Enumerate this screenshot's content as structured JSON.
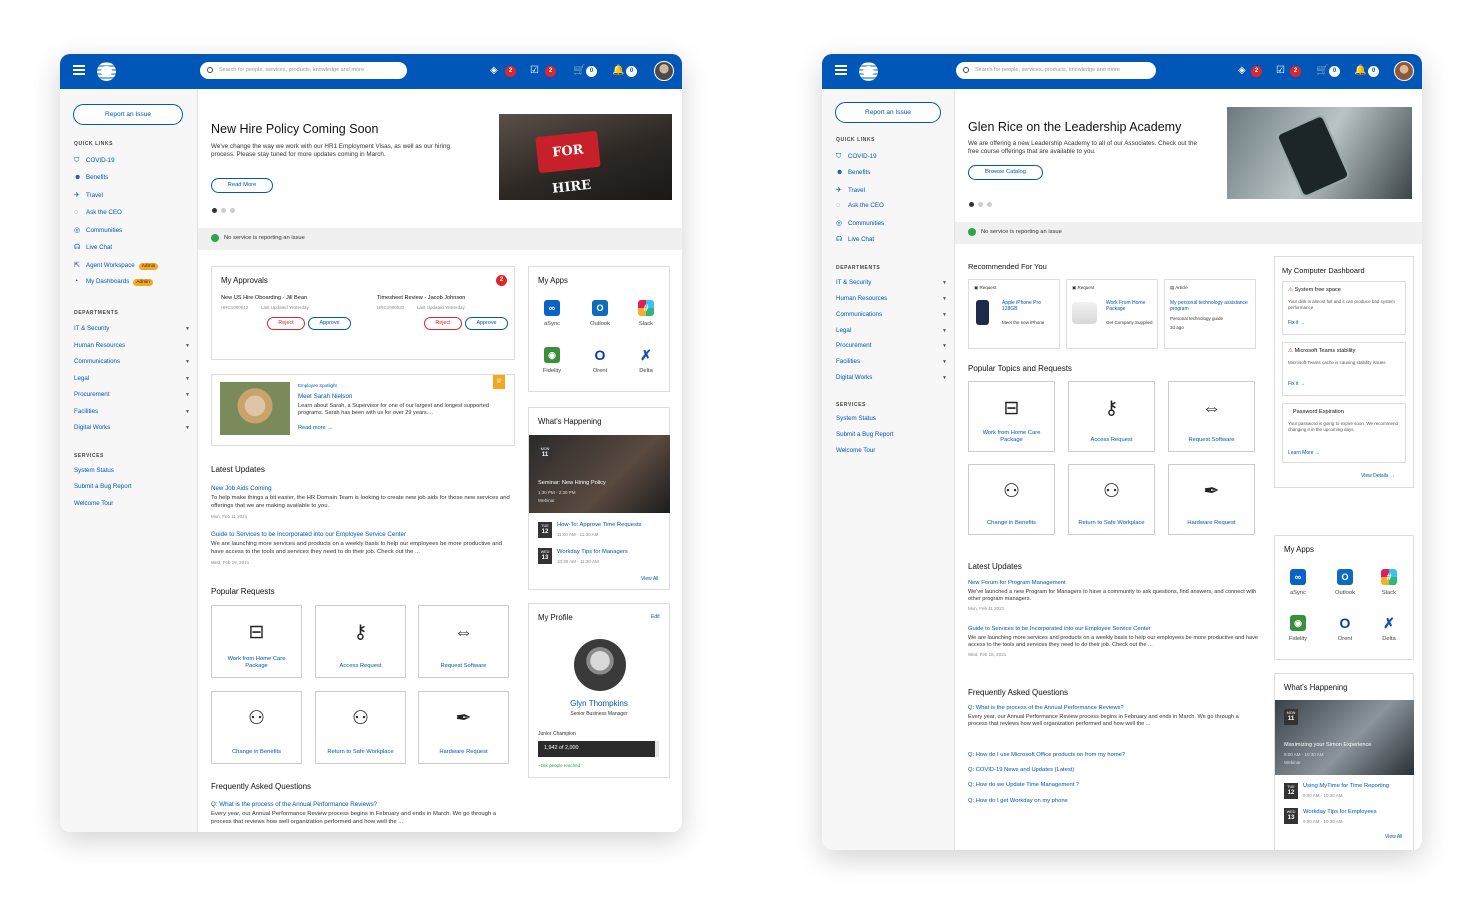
{
  "search": {
    "placeholder": "Search for people, services, products, knowledge and more"
  },
  "header": {
    "tickets_count": "2",
    "tasks_count": "2",
    "cart_count": "0",
    "notifications_count": "0"
  },
  "sidebar": {
    "report_button": "Report an Issue",
    "quick_links_heading": "QUICK LINKS",
    "departments_heading": "DEPARTMENTS",
    "services_heading": "SERVICES",
    "admin_badge": "Admin",
    "quick_links_a": [
      "COVID-19",
      "Benefits",
      "Travel",
      "Ask the CEO",
      "Communities",
      "Live Chat",
      "Agent Workspace",
      "My Dashboards"
    ],
    "quick_links_b": [
      "COVID-19",
      "Benefits",
      "Travel",
      "Ask the CEO",
      "Communities",
      "Live Chat"
    ],
    "departments": [
      "IT & Security",
      "Human Resources",
      "Communications",
      "Legal",
      "Procurement",
      "Facilities",
      "Digital Works"
    ],
    "services": [
      "System Status",
      "Submit a Bug Report",
      "Welcome Tour"
    ]
  },
  "screen_a": {
    "hero": {
      "title": "New Hire Policy Coming Soon",
      "desc": "We've change the way we work with our HR1 Employment Visas, as well as our hiring process. Please stay tuned for more updates coming in March.",
      "button": "Read More",
      "image_sign": "FOR HIRE"
    },
    "status": "No service is reporting an issue",
    "approvals": {
      "title": "My Approvals",
      "count": "2",
      "items": [
        {
          "title": "New US Hire Oboarding - Jill Bean",
          "id": "HRC1000012",
          "updated": "Last Updated Yesterday",
          "reject": "Reject",
          "approve": "Approve"
        },
        {
          "title": "Timesheet Review - Jacob Johnson",
          "id": "HRC1000032",
          "updated": "Last Updated Yesterday",
          "reject": "Reject",
          "approve": "Approve"
        }
      ]
    },
    "spotlight": {
      "tag": "Employee Spotlight",
      "name": "Meet Sarah Nielson",
      "desc": "Learn about Sarah, a Supervisor for one of our largest and longest supported programs. Sarah has been with us for over 29 years....",
      "link": "Read more →"
    },
    "latest_updates": {
      "title": "Latest Updates",
      "items": [
        {
          "title": "New Job Aids Coming",
          "desc": "To help make things a bit easier, the HR Domain Team is looking to create new job aids for those new services and offerings that we are making available to you.",
          "date": "Mon, Feb 11 2021"
        },
        {
          "title": "Guide to Services to be Incorporated into our Employee Service Center",
          "desc": "We are launching more services and products on a weekly basis to help our employees be more productive and have access to the tools and services they need to do their job. Check out the ...",
          "date": "Wed, Feb 18, 2021"
        }
      ]
    },
    "popular_requests": {
      "title": "Popular Requests",
      "items": [
        "Work from Home Care Package",
        "Access Request",
        "Request Software",
        "Change in Benefits",
        "Return to Safe Workplace",
        "Hardware Request"
      ]
    },
    "faq": {
      "title": "Frequently Asked Questions",
      "q1": "Q: What is the process of the Annual Performance Reviews?",
      "a1": "Every year, our Annual Performance Review process begins in February and ends in March. We go through a process that reviews how well organization performed and how well the ..."
    },
    "apps": {
      "title": "My Apps",
      "items": [
        "aSync",
        "Outlook",
        "Slack",
        "Fidelity",
        "Orent",
        "Delta"
      ]
    },
    "happening": {
      "title": "What's Happening",
      "featured": {
        "month": "MON",
        "day": "11",
        "title": "Seminar: New Hiring Policy",
        "time": "1:30 PM - 2:30 PM",
        "type": "Webinar"
      },
      "events": [
        {
          "month": "TUE",
          "day": "12",
          "title": "How-To: Approve Time Requests",
          "time": "11:00 AM - 11:30 AM"
        },
        {
          "month": "WED",
          "day": "13",
          "title": "Workday Tips for Managers",
          "time": "10:30 AM - 11:30 AM"
        }
      ],
      "view_all": "View All"
    },
    "profile": {
      "title": "My Profile",
      "edit": "Edit",
      "name": "Glyn Thompkins",
      "role": "Senior Business Manager",
      "level": "Junior Champion",
      "progress_text": "1,942 of 2,000",
      "progress_value": 0.971,
      "reached": "~15k people reached"
    }
  },
  "screen_b": {
    "hero": {
      "title": "Glen Rice on the Leadership Academy",
      "desc": "We are offering a new Leadership Academy to all of our Associates. Check out the free course offerings that are available to you.",
      "button": "Browse Catalog"
    },
    "status": "No service is reporting an issue",
    "recommended": {
      "title": "Recommended For You",
      "items": [
        {
          "type": "Request",
          "title": "Apple iPhone Pro 128GB",
          "desc": "Meet the new iPhone"
        },
        {
          "type": "Request",
          "title": "Work From Home Package",
          "desc": "Get Company Supplied"
        },
        {
          "type": "Article",
          "title": "My personal technology assistance program",
          "desc": "Personal technology guide",
          "date": "3d ago"
        }
      ]
    },
    "popular_topics": {
      "title": "Popular Topics and Requests",
      "items": [
        "Work from Home Care Package",
        "Access Request",
        "Request Software",
        "Change in Benefits",
        "Return to Safe Workplace",
        "Hardware Request"
      ]
    },
    "latest_updates": {
      "title": "Latest Updates",
      "items": [
        {
          "title": "New Forum for Program Management",
          "desc": "We've launched a new Program for Managers to have a community to ask questions, find answers, and connect with other program managers.",
          "date": "Mon, Feb 11 2021"
        },
        {
          "title": "Guide to Services to be Incorporated into our Employee Service Center",
          "desc": "We are launching more services and products on a weekly basis to help our employees be more productive and have access to the tools and services they need to do their job. Check out the ...",
          "date": "Wed, Feb 18, 2021"
        }
      ]
    },
    "faq": {
      "title": "Frequently Asked Questions",
      "q1": "Q: What is the process of the Annual Performance Reviews?",
      "a1": "Every year, our Annual Performance Review process begins in February and ends in March. We go through a process that reviews how well organization performed and how well the ...",
      "questions": [
        "Q: How do I use Microsoft Office products on from my home?",
        "Q: COVID-19 News and Updates (Latest)",
        "Q: How do we Update Time Management ?",
        "Q: How do I get Workday on my phone"
      ]
    },
    "dashboard": {
      "title": "My Computer Dashboard",
      "items": [
        {
          "title": "System free space",
          "desc": "Your disk is almost full and it can produce bad system performance",
          "link": "Fix it →"
        },
        {
          "title": "Microsoft Teams stability",
          "desc": "Microsoft Teams cache is causing stability issues",
          "link": "Fix it →"
        },
        {
          "title": "Password Expiration",
          "desc": "Your password is going to expire soon. We recommend changing it in the upcoming days.",
          "link": "Learn More →"
        }
      ],
      "view_details": "View Details →"
    },
    "apps": {
      "title": "My Apps",
      "items": [
        "aSync",
        "Outlook",
        "Slack",
        "Fidelity",
        "Orent",
        "Delta"
      ]
    },
    "happening": {
      "title": "What's Happening",
      "featured": {
        "month": "MON",
        "day": "11",
        "title": "Maximizing your Simon Experience",
        "time": "9:00 AM - 10:30 AM",
        "type": "Webinar"
      },
      "events": [
        {
          "month": "TUE",
          "day": "12",
          "title": "Using MyTime for Time Reporting",
          "time": "9:00 AM - 10:30 AM"
        },
        {
          "month": "WED",
          "day": "13",
          "title": "Workday Tips for Employees",
          "time": "9:00 AM - 10:30 AM"
        }
      ],
      "view_all": "View All"
    }
  },
  "colors": {
    "brand": "#0057b8",
    "danger": "#e0262b",
    "success": "#2da44e",
    "admin": "#f5a623"
  }
}
